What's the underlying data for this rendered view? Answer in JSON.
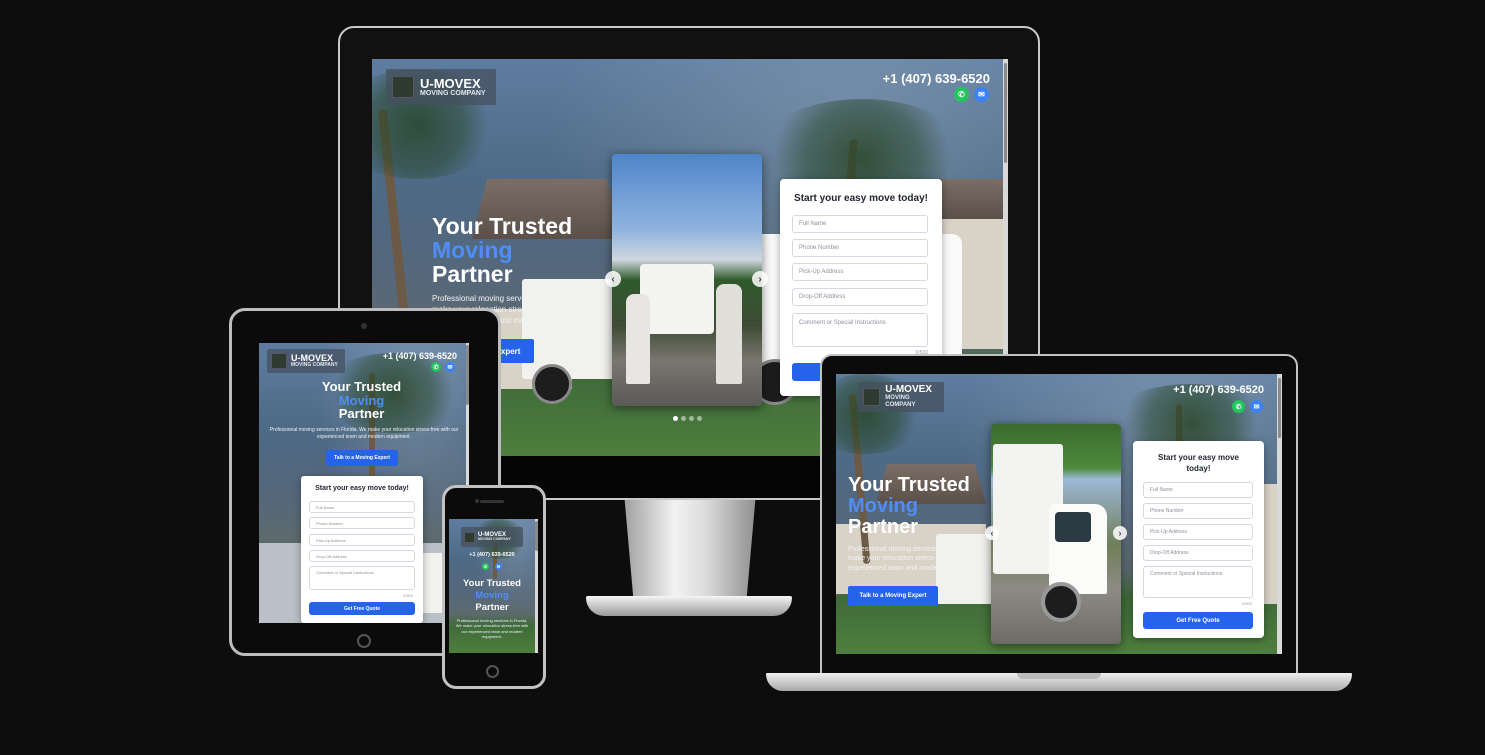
{
  "brand": {
    "name": "U-MOVEX",
    "tagline": "MOVING COMPANY"
  },
  "contact": {
    "phone": "+1 (407) 639-6520",
    "whatsapp_icon": "whatsapp-icon",
    "messenger_icon": "messenger-icon"
  },
  "hero": {
    "line1": "Your Trusted",
    "line2": "Moving",
    "line3": "Partner",
    "description": "Professional moving services in Florida. We make your relocation stress-free with our experienced team and modern equipment.",
    "cta_label": "Talk to a Moving Expert",
    "cta_label_partial": "Expert"
  },
  "form": {
    "title": "Start your easy move today!",
    "full_name_placeholder": "Full Name",
    "phone_placeholder": "Phone Number",
    "pickup_placeholder": "Pick-Up Address",
    "dropoff_placeholder": "Drop-Off Address",
    "comment_placeholder": "Comment or Special Instructions",
    "char_count": "0/500",
    "submit_label": "Get Free Quote"
  },
  "carousel": {
    "prev_icon": "chevron-left-icon",
    "next_icon": "chevron-right-icon",
    "prev_glyph": "‹",
    "next_glyph": "›",
    "slide_count": 4,
    "active_slide": 1
  },
  "colors": {
    "accent": "#2563eb",
    "highlight": "#4f8ef7",
    "whatsapp": "#22c55e",
    "messenger": "#3b82f6",
    "background": "#0d0d0d"
  }
}
